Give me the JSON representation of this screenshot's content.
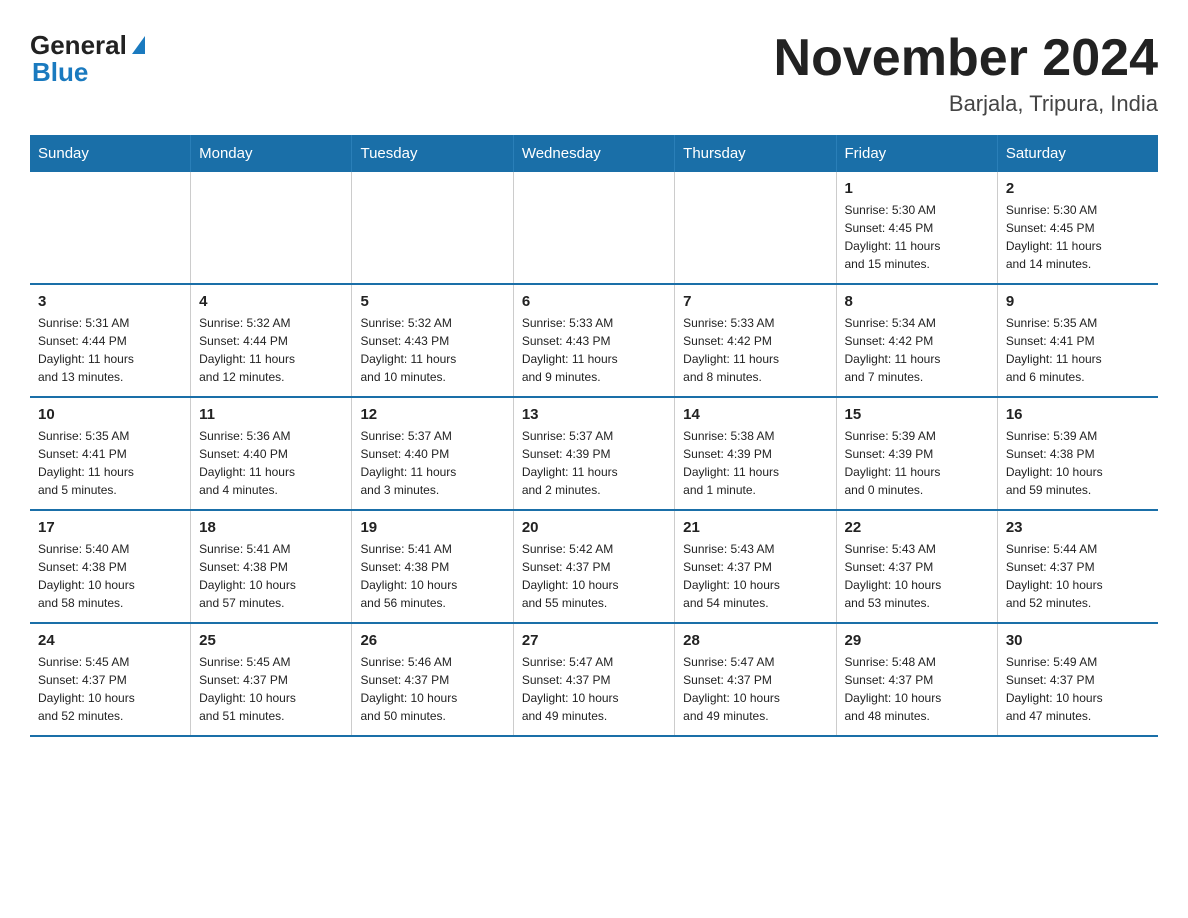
{
  "logo": {
    "general": "General",
    "blue": "Blue"
  },
  "title": "November 2024",
  "location": "Barjala, Tripura, India",
  "days_of_week": [
    "Sunday",
    "Monday",
    "Tuesday",
    "Wednesday",
    "Thursday",
    "Friday",
    "Saturday"
  ],
  "weeks": [
    [
      {
        "day": "",
        "info": ""
      },
      {
        "day": "",
        "info": ""
      },
      {
        "day": "",
        "info": ""
      },
      {
        "day": "",
        "info": ""
      },
      {
        "day": "",
        "info": ""
      },
      {
        "day": "1",
        "info": "Sunrise: 5:30 AM\nSunset: 4:45 PM\nDaylight: 11 hours\nand 15 minutes."
      },
      {
        "day": "2",
        "info": "Sunrise: 5:30 AM\nSunset: 4:45 PM\nDaylight: 11 hours\nand 14 minutes."
      }
    ],
    [
      {
        "day": "3",
        "info": "Sunrise: 5:31 AM\nSunset: 4:44 PM\nDaylight: 11 hours\nand 13 minutes."
      },
      {
        "day": "4",
        "info": "Sunrise: 5:32 AM\nSunset: 4:44 PM\nDaylight: 11 hours\nand 12 minutes."
      },
      {
        "day": "5",
        "info": "Sunrise: 5:32 AM\nSunset: 4:43 PM\nDaylight: 11 hours\nand 10 minutes."
      },
      {
        "day": "6",
        "info": "Sunrise: 5:33 AM\nSunset: 4:43 PM\nDaylight: 11 hours\nand 9 minutes."
      },
      {
        "day": "7",
        "info": "Sunrise: 5:33 AM\nSunset: 4:42 PM\nDaylight: 11 hours\nand 8 minutes."
      },
      {
        "day": "8",
        "info": "Sunrise: 5:34 AM\nSunset: 4:42 PM\nDaylight: 11 hours\nand 7 minutes."
      },
      {
        "day": "9",
        "info": "Sunrise: 5:35 AM\nSunset: 4:41 PM\nDaylight: 11 hours\nand 6 minutes."
      }
    ],
    [
      {
        "day": "10",
        "info": "Sunrise: 5:35 AM\nSunset: 4:41 PM\nDaylight: 11 hours\nand 5 minutes."
      },
      {
        "day": "11",
        "info": "Sunrise: 5:36 AM\nSunset: 4:40 PM\nDaylight: 11 hours\nand 4 minutes."
      },
      {
        "day": "12",
        "info": "Sunrise: 5:37 AM\nSunset: 4:40 PM\nDaylight: 11 hours\nand 3 minutes."
      },
      {
        "day": "13",
        "info": "Sunrise: 5:37 AM\nSunset: 4:39 PM\nDaylight: 11 hours\nand 2 minutes."
      },
      {
        "day": "14",
        "info": "Sunrise: 5:38 AM\nSunset: 4:39 PM\nDaylight: 11 hours\nand 1 minute."
      },
      {
        "day": "15",
        "info": "Sunrise: 5:39 AM\nSunset: 4:39 PM\nDaylight: 11 hours\nand 0 minutes."
      },
      {
        "day": "16",
        "info": "Sunrise: 5:39 AM\nSunset: 4:38 PM\nDaylight: 10 hours\nand 59 minutes."
      }
    ],
    [
      {
        "day": "17",
        "info": "Sunrise: 5:40 AM\nSunset: 4:38 PM\nDaylight: 10 hours\nand 58 minutes."
      },
      {
        "day": "18",
        "info": "Sunrise: 5:41 AM\nSunset: 4:38 PM\nDaylight: 10 hours\nand 57 minutes."
      },
      {
        "day": "19",
        "info": "Sunrise: 5:41 AM\nSunset: 4:38 PM\nDaylight: 10 hours\nand 56 minutes."
      },
      {
        "day": "20",
        "info": "Sunrise: 5:42 AM\nSunset: 4:37 PM\nDaylight: 10 hours\nand 55 minutes."
      },
      {
        "day": "21",
        "info": "Sunrise: 5:43 AM\nSunset: 4:37 PM\nDaylight: 10 hours\nand 54 minutes."
      },
      {
        "day": "22",
        "info": "Sunrise: 5:43 AM\nSunset: 4:37 PM\nDaylight: 10 hours\nand 53 minutes."
      },
      {
        "day": "23",
        "info": "Sunrise: 5:44 AM\nSunset: 4:37 PM\nDaylight: 10 hours\nand 52 minutes."
      }
    ],
    [
      {
        "day": "24",
        "info": "Sunrise: 5:45 AM\nSunset: 4:37 PM\nDaylight: 10 hours\nand 52 minutes."
      },
      {
        "day": "25",
        "info": "Sunrise: 5:45 AM\nSunset: 4:37 PM\nDaylight: 10 hours\nand 51 minutes."
      },
      {
        "day": "26",
        "info": "Sunrise: 5:46 AM\nSunset: 4:37 PM\nDaylight: 10 hours\nand 50 minutes."
      },
      {
        "day": "27",
        "info": "Sunrise: 5:47 AM\nSunset: 4:37 PM\nDaylight: 10 hours\nand 49 minutes."
      },
      {
        "day": "28",
        "info": "Sunrise: 5:47 AM\nSunset: 4:37 PM\nDaylight: 10 hours\nand 49 minutes."
      },
      {
        "day": "29",
        "info": "Sunrise: 5:48 AM\nSunset: 4:37 PM\nDaylight: 10 hours\nand 48 minutes."
      },
      {
        "day": "30",
        "info": "Sunrise: 5:49 AM\nSunset: 4:37 PM\nDaylight: 10 hours\nand 47 minutes."
      }
    ]
  ]
}
